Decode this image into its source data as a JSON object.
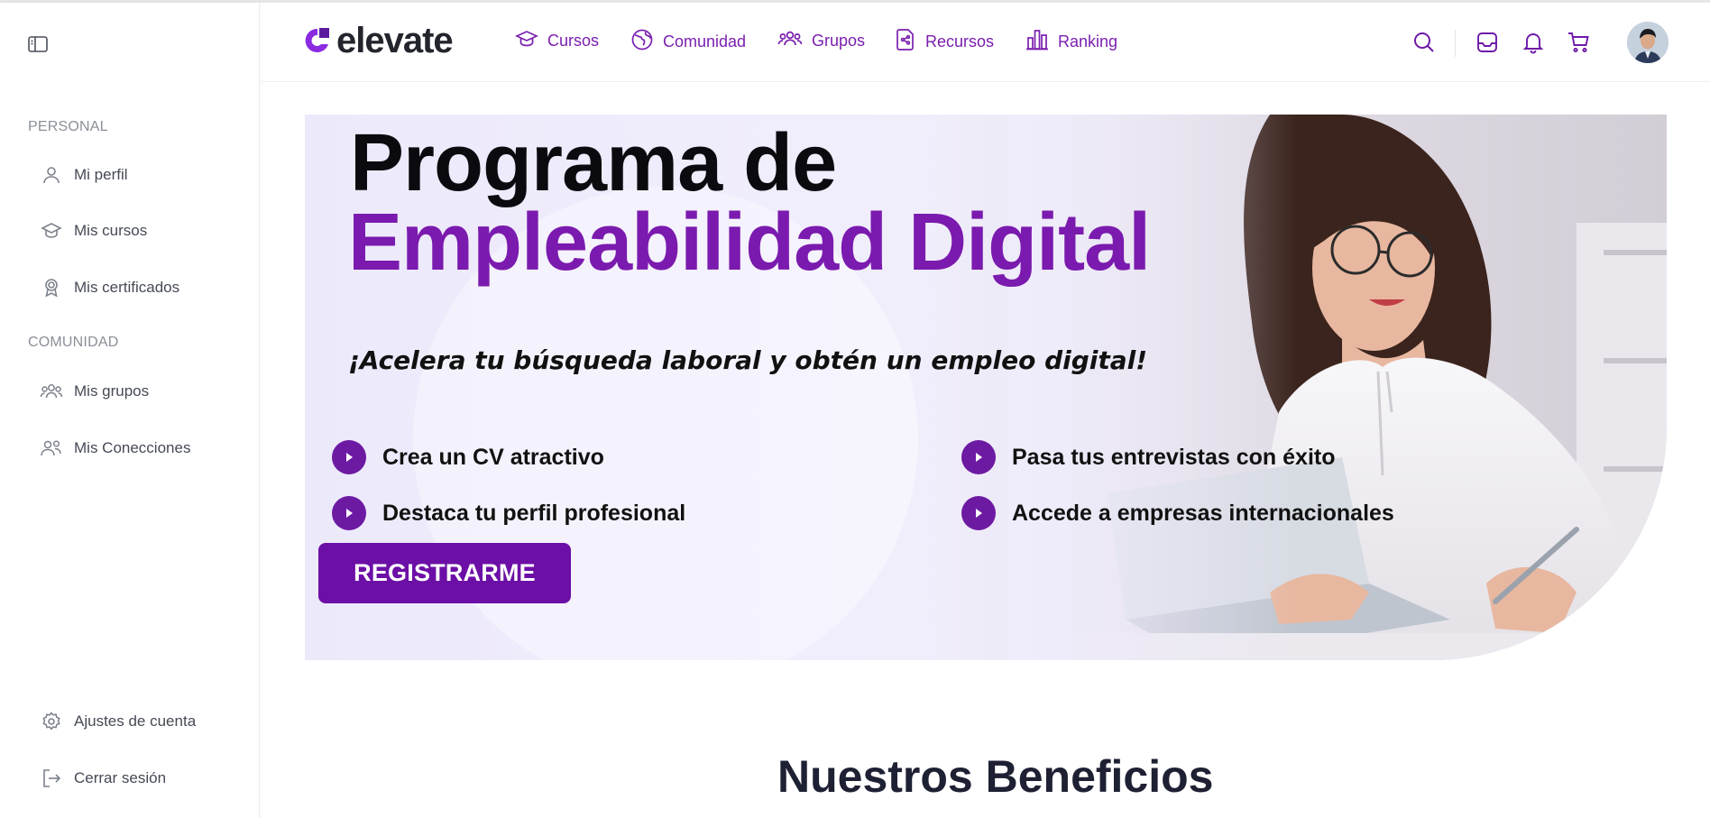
{
  "sidebar": {
    "sections": [
      {
        "title": "PERSONAL",
        "items": [
          {
            "label": "Mi perfil",
            "icon": "user-icon"
          },
          {
            "label": "Mis cursos",
            "icon": "graduation-cap-icon"
          },
          {
            "label": "Mis certificados",
            "icon": "certificate-icon"
          }
        ]
      },
      {
        "title": "COMUNIDAD",
        "items": [
          {
            "label": "Mis grupos",
            "icon": "group-icon"
          },
          {
            "label": "Mis Conecciones",
            "icon": "connections-icon"
          }
        ]
      }
    ],
    "bottom": [
      {
        "label": "Ajustes de cuenta",
        "icon": "gear-icon"
      },
      {
        "label": "Cerrar sesión",
        "icon": "logout-icon"
      }
    ]
  },
  "header": {
    "logo_text": "elevate",
    "nav": [
      {
        "label": "Cursos",
        "icon": "graduation-cap-icon"
      },
      {
        "label": "Comunidad",
        "icon": "globe-icon"
      },
      {
        "label": "Grupos",
        "icon": "group-icon"
      },
      {
        "label": "Recursos",
        "icon": "share-file-icon"
      },
      {
        "label": "Ranking",
        "icon": "bar-chart-icon"
      }
    ],
    "actions": [
      "search-icon",
      "inbox-icon",
      "bell-icon",
      "cart-icon"
    ]
  },
  "hero": {
    "title_line1": "Programa de",
    "title_line2": "Empleabilidad Digital",
    "subtitle": "¡Acelera tu búsqueda laboral y obtén un empleo digital!",
    "features": [
      "Crea un CV atractivo",
      "Destaca tu perfil profesional",
      "Pasa tus entrevistas con éxito",
      "Accede a empresas internacionales"
    ],
    "cta_label": "REGISTRARME"
  },
  "section": {
    "title": "Nuestros Beneficios"
  },
  "colors": {
    "accent": "#7b1aae",
    "button": "#6c0fa6",
    "nav_text": "#7a1fb0",
    "heading_dark": "#1e2033"
  }
}
